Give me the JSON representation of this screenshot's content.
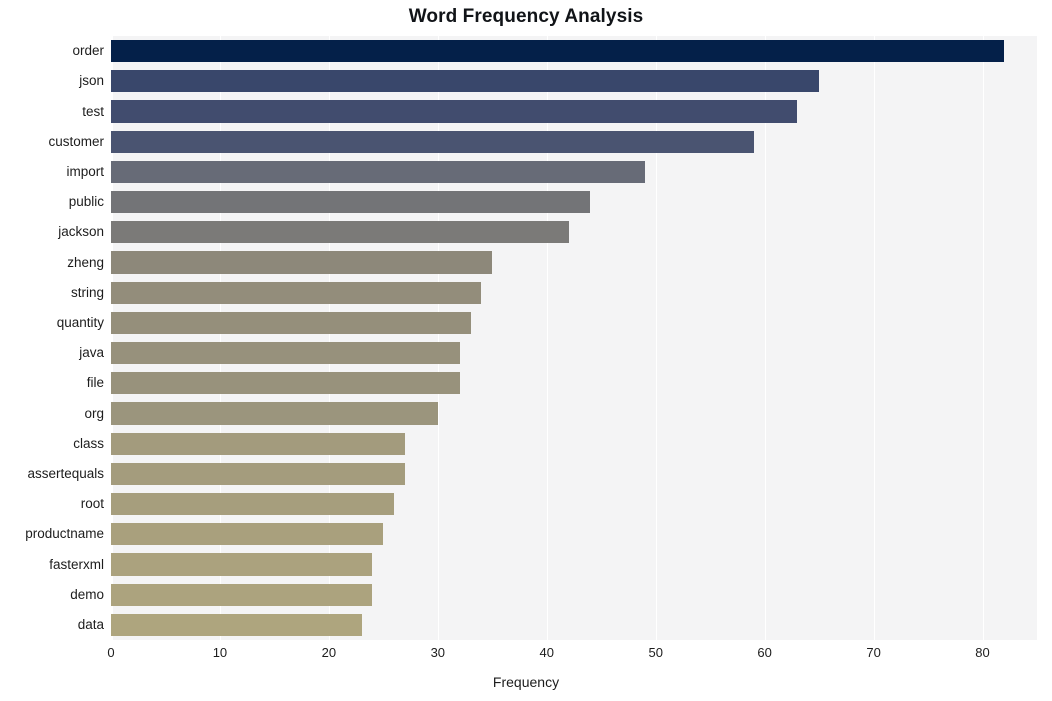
{
  "chart_data": {
    "type": "bar",
    "orientation": "horizontal",
    "title": "Word Frequency Analysis",
    "xlabel": "Frequency",
    "ylabel": "",
    "xlim": [
      0,
      85
    ],
    "ylim": null,
    "grid": true,
    "legend": null,
    "xticks": [
      0,
      10,
      20,
      30,
      40,
      50,
      60,
      70,
      80
    ],
    "xtick_labels": [
      "0",
      "10",
      "20",
      "30",
      "40",
      "50",
      "60",
      "70",
      "80"
    ],
    "categories": [
      "order",
      "json",
      "test",
      "customer",
      "import",
      "public",
      "jackson",
      "zheng",
      "string",
      "quantity",
      "java",
      "file",
      "org",
      "class",
      "assertequals",
      "root",
      "productname",
      "fasterxml",
      "demo",
      "data"
    ],
    "values": [
      82,
      65,
      63,
      59,
      49,
      44,
      42,
      35,
      34,
      33,
      32,
      32,
      30,
      27,
      27,
      26,
      25,
      24,
      24,
      23
    ],
    "bar_colors": [
      "#042049",
      "#39476b",
      "#414c6e",
      "#4a5471",
      "#676b77",
      "#737477",
      "#7b7a78",
      "#8d887a",
      "#938d7b",
      "#958f7b",
      "#97917c",
      "#98927c",
      "#9b957d",
      "#a39b7d",
      "#a49c7d",
      "#a69e7d",
      "#a9a07d",
      "#aba27e",
      "#aca37e",
      "#aea57e"
    ],
    "plot_background": "#f4f4f5",
    "gridline_color": "#ffffff",
    "figure_background": "#ffffff",
    "title_color": "#111418",
    "tick_label_color": "#1d1d1d"
  }
}
